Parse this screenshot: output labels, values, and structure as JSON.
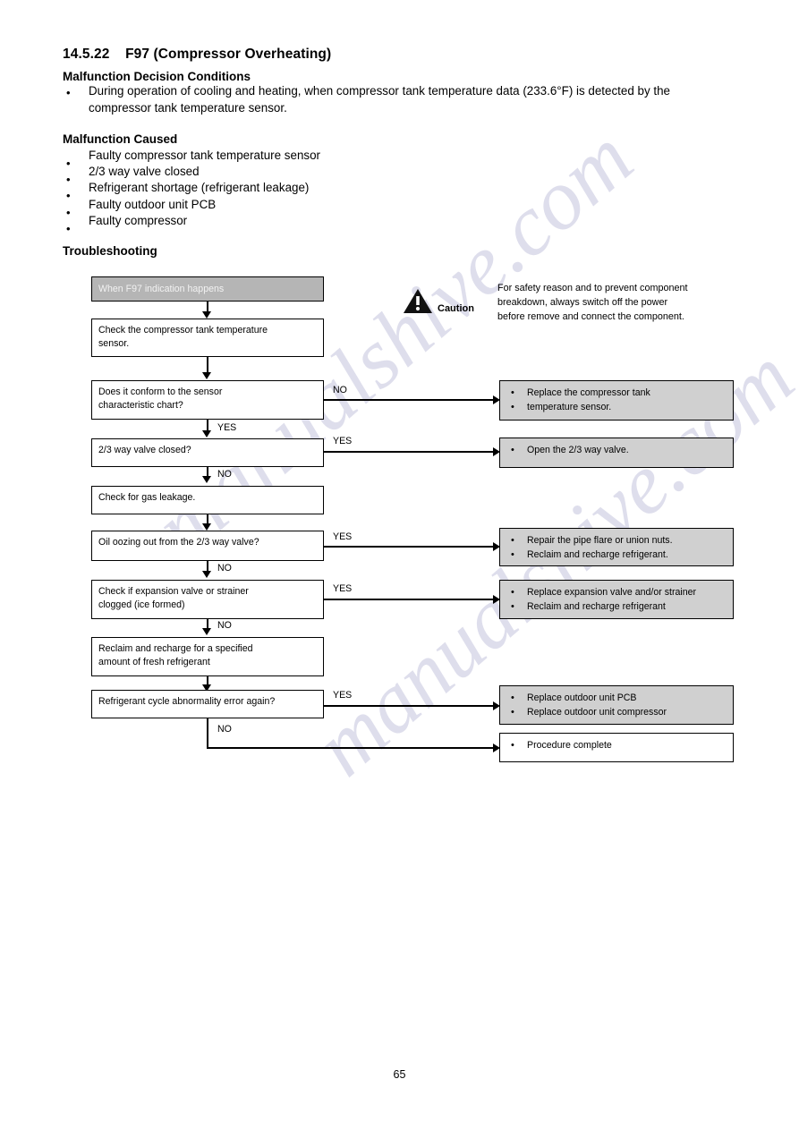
{
  "document": {
    "section_number": "14.5.22",
    "section_title": "F97 (Compressor Overheating)",
    "page_number": "65",
    "watermark_text": "manualshive.com"
  },
  "malfunction_decision": {
    "heading": "Malfunction Decision Conditions",
    "bullet_lines": [
      "During operation of cooling and heating, when compressor tank temperature data (233.6°F) is detected by the",
      "compressor tank temperature sensor."
    ]
  },
  "malfunction_caused": {
    "heading": "Malfunction Caused",
    "items": [
      "Faulty compressor tank temperature sensor",
      "2/3 way valve closed",
      "Refrigerant shortage (refrigerant leakage)",
      "Faulty outdoor unit PCB",
      "Faulty compressor"
    ]
  },
  "troubleshooting": {
    "heading": "Troubleshooting",
    "caution": {
      "icon": "warning-triangle-icon",
      "label": "Caution",
      "lines": [
        "For safety reason and to prevent component",
        "breakdown, always switch off the power",
        "before remove and connect the component."
      ]
    },
    "start_box": "When F97 indication happens",
    "steps": [
      {
        "lines": [
          "Check the compressor tank temperature",
          "sensor."
        ]
      },
      {
        "lines": [
          "Does it conform to the sensor",
          "characteristic chart?"
        ]
      },
      {
        "lines": [
          "2/3 way valve closed?"
        ]
      },
      {
        "lines": [
          "Check for gas leakage."
        ]
      },
      {
        "lines": [
          "Oil oozing out from the 2/3 way valve?"
        ]
      },
      {
        "lines": [
          "Check if expansion valve or strainer",
          "clogged (ice formed)"
        ]
      },
      {
        "lines": [
          "Reclaim and recharge for a specified",
          "amount of fresh refrigerant"
        ]
      },
      {
        "lines": [
          "Refrigerant cycle abnormality error again?"
        ]
      }
    ],
    "branch_labels": {
      "no": "NO",
      "yes": "YES"
    },
    "flow_labels": {
      "conform_branch_out": "NO",
      "conform_branch_down": "YES",
      "valve_branch_out": "YES",
      "valve_branch_down": "NO",
      "oil_branch_out": "YES",
      "oil_branch_down": "NO",
      "expansion_branch_out": "YES",
      "expansion_branch_down": "NO",
      "cycle_branch_out": "YES",
      "cycle_branch_down": "NO"
    },
    "results": [
      {
        "shaded": true,
        "items": [
          "Replace the compressor tank",
          "temperature sensor."
        ]
      },
      {
        "shaded": true,
        "items": [
          "Open the 2/3 way valve."
        ]
      },
      {
        "shaded": true,
        "items": [
          "Repair the pipe flare or union nuts.",
          "Reclaim and recharge refrigerant."
        ]
      },
      {
        "shaded": true,
        "items": [
          "Replace expansion valve and/or strainer",
          "Reclaim and recharge refrigerant"
        ]
      },
      {
        "shaded": true,
        "items": [
          "Replace outdoor unit PCB",
          "Replace outdoor unit compressor"
        ]
      },
      {
        "shaded": false,
        "items": [
          "Procedure complete"
        ]
      }
    ]
  },
  "colors": {
    "start_box_fill": "#b5b5b5",
    "result_box_fill": "#d0d0d0",
    "line": "#000000",
    "watermark": "#3a3a8c"
  }
}
